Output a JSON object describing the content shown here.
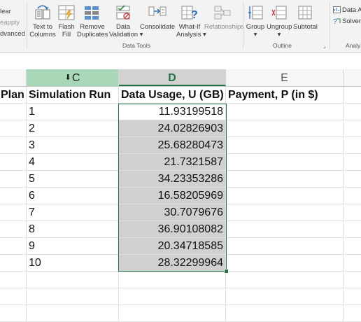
{
  "ribbon": {
    "left_commands": [
      {
        "label": "lear",
        "dim": false
      },
      {
        "label": "eapply",
        "dim": true
      },
      {
        "label": "dvanced",
        "dim": false
      }
    ],
    "data_tools": [
      {
        "line1": "Text to",
        "line2": "Columns",
        "icon": "text-to-columns-icon"
      },
      {
        "line1": "Flash",
        "line2": "Fill",
        "icon": "flash-fill-icon"
      },
      {
        "line1": "Remove",
        "line2": "Duplicates",
        "icon": "remove-duplicates-icon"
      },
      {
        "line1": "Data",
        "line2": "Validation ▾",
        "icon": "data-validation-icon"
      },
      {
        "line1": "Consolidate",
        "line2": "",
        "icon": "consolidate-icon"
      },
      {
        "line1": "What-If",
        "line2": "Analysis ▾",
        "icon": "what-if-analysis-icon"
      },
      {
        "line1": "Relationships",
        "line2": "",
        "icon": "relationships-icon",
        "dim": true
      }
    ],
    "data_tools_label": "Data Tools",
    "outline": [
      {
        "line1": "Group",
        "line2": "▾",
        "icon": "group-icon"
      },
      {
        "line1": "Ungroup",
        "line2": "▾",
        "icon": "ungroup-icon"
      },
      {
        "line1": "Subtotal",
        "line2": "",
        "icon": "subtotal-icon"
      }
    ],
    "outline_label": "Outline",
    "analysis": [
      {
        "label": "Data A",
        "icon": "data-analysis-icon"
      },
      {
        "label": "Solver",
        "icon": "solver-icon"
      }
    ],
    "analysis_label": "Analy"
  },
  "sheet": {
    "column_headers": [
      {
        "label": "",
        "key": "b"
      },
      {
        "label": "C",
        "key": "c"
      },
      {
        "label": "D",
        "key": "d"
      },
      {
        "label": "E",
        "key": "e"
      },
      {
        "label": "",
        "key": "f"
      }
    ],
    "header_row": {
      "b": "Plan",
      "c": "Simulation Run",
      "d": "Data Usage, U (GB)",
      "e": "Payment, P (in $)"
    },
    "runs": [
      "1",
      "2",
      "3",
      "4",
      "5",
      "6",
      "7",
      "8",
      "9",
      "10"
    ],
    "data_usage": [
      "11.93199518",
      "24.02826903",
      "25.68280473",
      "21.7321587",
      "34.23353286",
      "16.58205969",
      "30.7079676",
      "36.90108082",
      "20.34718585",
      "28.32299964"
    ]
  },
  "colors": {
    "accent_green": "#217346",
    "selection_gray": "#d0d0d0",
    "column_highlight": "#a9d8b8"
  }
}
